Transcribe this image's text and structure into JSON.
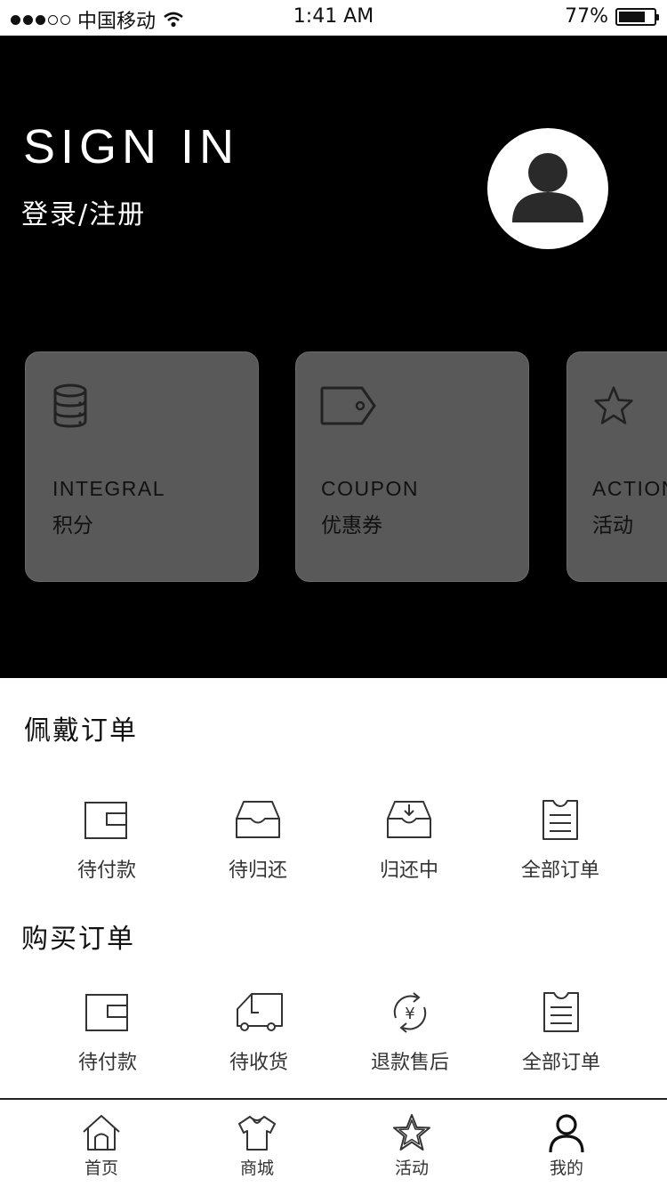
{
  "status_bar": {
    "carrier": "中国移动",
    "time": "1:41 AM",
    "battery_text": "77%",
    "battery_level": 0.77
  },
  "header": {
    "title": "SIGN IN",
    "subtitle": "登录/注册",
    "avatar_icon": "user-avatar-icon"
  },
  "cards": [
    {
      "en": "INTEGRAL",
      "zh": "积分",
      "icon": "database-icon"
    },
    {
      "en": "COUPON",
      "zh": "优惠券",
      "icon": "tag-icon"
    },
    {
      "en": "ACTION",
      "zh": "活动",
      "icon": "star-icon"
    }
  ],
  "wear_orders": {
    "title": "佩戴订单",
    "items": [
      {
        "label": "待付款",
        "icon": "wallet-icon"
      },
      {
        "label": "待归还",
        "icon": "inbox-tray-icon"
      },
      {
        "label": "归还中",
        "icon": "inbox-download-icon"
      },
      {
        "label": "全部订单",
        "icon": "order-list-icon"
      }
    ]
  },
  "buy_orders": {
    "title": "购买订单",
    "items": [
      {
        "label": "待付款",
        "icon": "wallet-icon"
      },
      {
        "label": "待收货",
        "icon": "truck-icon"
      },
      {
        "label": "退款售后",
        "icon": "refund-yen-icon"
      },
      {
        "label": "全部订单",
        "icon": "order-list-icon"
      }
    ]
  },
  "refund_symbol": "¥",
  "tabbar": {
    "items": [
      {
        "label": "首页",
        "icon": "home-icon"
      },
      {
        "label": "商城",
        "icon": "shirt-icon"
      },
      {
        "label": "活动",
        "icon": "star-icon"
      },
      {
        "label": "我的",
        "icon": "profile-icon"
      }
    ],
    "active_index": 3
  }
}
